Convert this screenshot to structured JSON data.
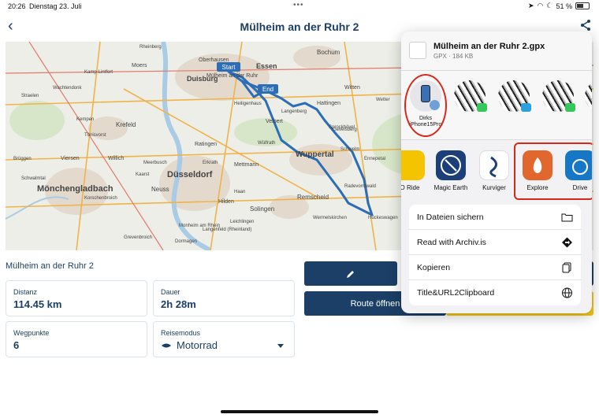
{
  "status_bar": {
    "time": "20:26",
    "date": "Dienstag 23. Juli",
    "battery": "51 %"
  },
  "header": {
    "title": "Mülheim an der Ruhr 2",
    "back_icon": "chevron-left-icon",
    "share_icon": "share-icon"
  },
  "map": {
    "labels": {
      "start": "Start",
      "end": "End",
      "cities": [
        "Duisburg",
        "Oberhausen",
        "Essen",
        "Bochum",
        "Mülheim an der Ruhr",
        "Moers",
        "Krefeld",
        "Velbert",
        "Wuppertal",
        "Düsseldorf",
        "Mettmann",
        "Hilden",
        "Solingen",
        "Remscheid",
        "Neuss",
        "Mönchengladbach",
        "Ratingen",
        "Hattingen",
        "Sprockhövel",
        "Gevelsberg",
        "Schwelm",
        "Langenberg",
        "Radevormwald",
        "Wermelskirchen",
        "Haan",
        "Willich",
        "Kaarst",
        "Meerbusch",
        "Monheim am Rhein",
        "Langenfeld (Rheinland)",
        "Leichlingen",
        "Schwalmtal",
        "Viersen",
        "Korschenbroich",
        "Grevenbroich",
        "Dormagen",
        "Kamp-Lintfort",
        "Rheinberg",
        "Wachtendonk",
        "Witten",
        "Wetter",
        "Ennepetal",
        "Tönisvorst",
        "Heiligenhaus",
        "Kempen",
        "Straelen",
        "Brüggen",
        "Erkrath",
        "Wülfrath",
        "Hückeswagen"
      ]
    }
  },
  "route_name": "Mülheim an der Ruhr 2",
  "cards": {
    "distance": {
      "label": "Distanz",
      "value": "114.45 km"
    },
    "duration": {
      "label": "Dauer",
      "value": "2h 28m"
    },
    "waypoints": {
      "label": "Wegpunkte",
      "value": "6"
    },
    "travel_mode": {
      "label": "Reisemodus",
      "value": "Motorrad"
    }
  },
  "buttons": {
    "edit_icon": "pencil-icon",
    "open_route": "Route öffnen"
  },
  "share_sheet": {
    "file_name": "Mülheim an der Ruhr 2.gpx",
    "file_meta": "GPX · 184 KB",
    "contacts": [
      {
        "name": "Dirks\niPhone15Pro",
        "label_line1": "Dirks",
        "label_line2": "iPhone15Pro"
      },
      {
        "name": ""
      },
      {
        "name": ""
      },
      {
        "name": ""
      }
    ],
    "apps": [
      {
        "label": "O Ride",
        "color": "#f4c400"
      },
      {
        "label": "Magic Earth",
        "color": "#1c3f7a"
      },
      {
        "label": "Kurviger",
        "color": "#ffffff"
      },
      {
        "label": "Explore",
        "color": "#e2672e"
      },
      {
        "label": "Drive",
        "color": "#1677c6"
      }
    ],
    "actions": [
      {
        "label": "In Dateien sichern",
        "icon": "folder-icon"
      },
      {
        "label": "Read with Archiv.is",
        "icon": "direction-icon"
      },
      {
        "label": "Kopieren",
        "icon": "copy-icon"
      },
      {
        "label": "Title&URL2Clipboard",
        "icon": "globe-icon"
      }
    ]
  },
  "colors": {
    "primary": "#1b3f66",
    "accent_yellow": "#f3c514",
    "route": "#2c6db8",
    "highlight_red": "#d8281c"
  }
}
